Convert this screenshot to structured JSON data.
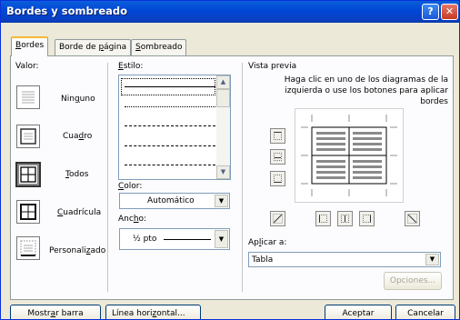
{
  "window": {
    "title": "Bordes y sombreado",
    "help": "?",
    "close": "✕"
  },
  "tabs": [
    {
      "label": "Bordes",
      "accel": "B",
      "rest": "ordes"
    },
    {
      "label": "Borde de página",
      "pre": "Borde de ",
      "accel": "p",
      "rest": "ágina"
    },
    {
      "label": "Sombreado",
      "accel": "S",
      "rest": "ombreado"
    }
  ],
  "valor": {
    "label": "Valor:",
    "items": [
      {
        "label": "Ninguno",
        "pre": "Nin",
        "accel": "g",
        "rest": "uno",
        "icon": "setting-none-icon"
      },
      {
        "label": "Cuadro",
        "pre": "Cua",
        "accel": "d",
        "rest": "ro",
        "icon": "setting-box-icon"
      },
      {
        "label": "Todos",
        "pre": "",
        "accel": "T",
        "rest": "odos",
        "icon": "setting-all-icon"
      },
      {
        "label": "Cuadrícula",
        "pre": "",
        "accel": "C",
        "rest": "uadrícula",
        "icon": "setting-grid-icon"
      },
      {
        "label": "Personalizado",
        "pre": "Personali",
        "accel": "z",
        "rest": "ado",
        "icon": "setting-custom-icon"
      }
    ]
  },
  "estilo": {
    "label": "Estilo:",
    "accel": "E",
    "rest": "stilo:"
  },
  "color": {
    "label": "Color:",
    "accel": "C",
    "rest": "olor:",
    "value": "Automático"
  },
  "ancho": {
    "label": "Ancho:",
    "pre": "Anc",
    "accel": "h",
    "rest": "o:",
    "value": "½ pto"
  },
  "preview": {
    "label": "Vista previa",
    "hint": "Haga clic en uno de los diagramas de la izquierda o use los botones para aplicar bordes"
  },
  "aplicar": {
    "label": "Aplicar a:",
    "pre": "Ap",
    "accel": "l",
    "rest": "icar a:",
    "value": "Tabla"
  },
  "buttons": {
    "opciones": "Opciones...",
    "mostrar": "Mostrar barra",
    "mostrar_pre": "Mostr",
    "mostrar_accel": "a",
    "mostrar_rest": "r barra",
    "linea": "Línea horizontal...",
    "linea_pre": "Línea hori",
    "linea_accel": "z",
    "linea_rest": "ontal...",
    "aceptar": "Aceptar",
    "cancelar": "Cancelar"
  },
  "colors": {
    "titlebar": "#0046d5",
    "dialog_bg": "#ece9d8",
    "tab_highlight": "#f7b93b",
    "input_border": "#7f9db9"
  }
}
